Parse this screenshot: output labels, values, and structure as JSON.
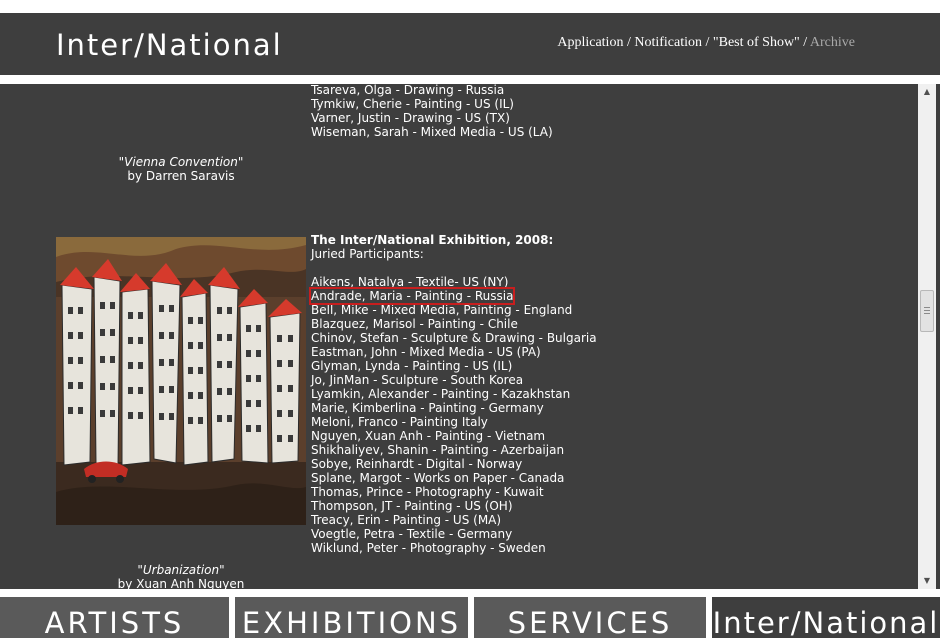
{
  "header": {
    "logo": "Inter/National",
    "nav": {
      "application": "Application",
      "notification": "Notification",
      "best_of_show": "\"Best of Show\"",
      "archive": "Archive",
      "separator": " / "
    }
  },
  "captions": {
    "first_title": "\"Vienna Convention\"",
    "first_by": "by Darren Saravis",
    "second_title": "\"Urbanization\"",
    "second_by": "by Xuan Anh Nguyen"
  },
  "list_2007_tail": [
    "Tsareva, Olga - Drawing - Russia",
    "Tymkiw, Cherie - Painting - US (IL)",
    "Varner, Justin - Drawing - US (TX)",
    "Wiseman, Sarah - Mixed Media - US (LA)"
  ],
  "exhibition_2008": {
    "title": "The Inter/National Exhibition, 2008:",
    "subtitle": "Juried Participants:",
    "participants": [
      "Aikens, Natalya - Textile- US (NY)",
      "Andrade, Maria - Painting - Russia",
      "Bell, Mike - Mixed Media, Painting - England",
      "Blazquez, Marisol - Painting - Chile",
      "Chinov, Stefan - Sculpture & Drawing - Bulgaria",
      "Eastman, John - Mixed Media - US (PA)",
      "Glyman, Lynda - Painting - US (IL)",
      "Jo, JinMan - Sculpture - South Korea",
      "Lyamkin, Alexander - Painting - Kazakhstan",
      "Marie, Kimberlina - Painting - Germany",
      "Meloni, Franco - Painting Italy",
      "Nguyen, Xuan Anh - Painting - Vietnam",
      "Shikhaliyev, Shanin - Painting - Azerbaijan",
      "Sobye, Reinhardt - Digital - Norway",
      "Splane, Margot - Works on Paper - Canada",
      "Thomas, Prince - Photography - Kuwait",
      "Thompson, JT - Painting - US (OH)",
      "Treacy, Erin - Painting - US (MA)",
      "Voegtle, Petra - Textile - Germany",
      "Wiklund, Peter - Photography - Sweden"
    ]
  },
  "bottom_nav": {
    "artists": "ARTISTS",
    "exhibitions": "EXHIBITIONS",
    "services": "SERVICES",
    "brand": "Inter/National"
  },
  "colors": {
    "background": "#3e3e3e",
    "nav_button": "#5a5a5a",
    "highlight": "#c81e1e",
    "archive_link": "#a9a9a9"
  }
}
